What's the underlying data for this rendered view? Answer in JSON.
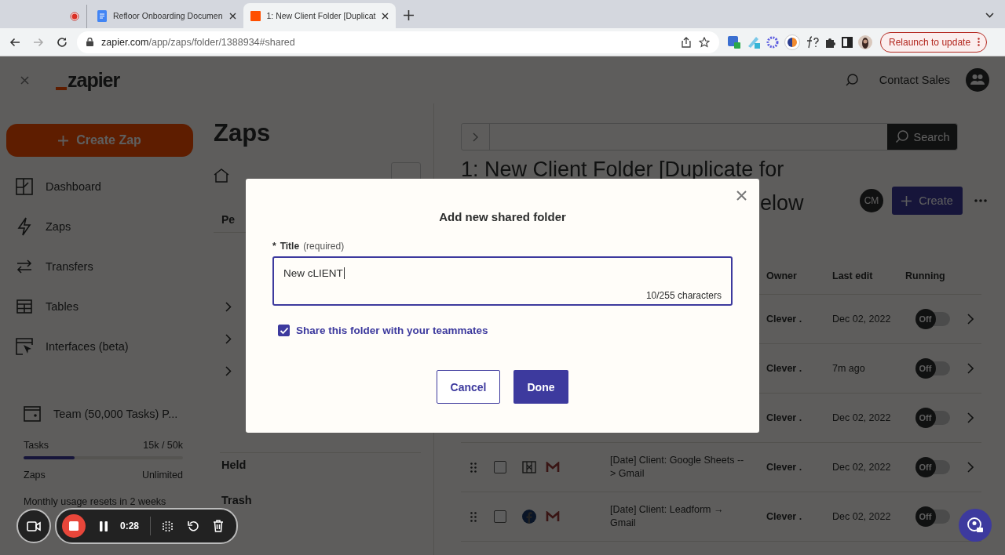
{
  "browser": {
    "tabs": [
      {
        "kind": "recording",
        "selected": false
      },
      {
        "kind": "doc",
        "title": "Refloor Onboarding Documen",
        "selected": false
      },
      {
        "kind": "zapier",
        "title": "1: New Client Folder [Duplicat",
        "selected": true
      }
    ],
    "url_host": "zapier.com",
    "url_path": "/app/zaps/folder/1388934#shared",
    "relaunch": "Relaunch to update"
  },
  "header": {
    "logo": "zapier",
    "contact": "Contact Sales"
  },
  "sidebar": {
    "create": "Create Zap",
    "items": [
      {
        "kind": "dashboard",
        "label": "Dashboard"
      },
      {
        "kind": "zaps",
        "label": "Zaps"
      },
      {
        "kind": "transfers",
        "label": "Transfers"
      },
      {
        "kind": "tables",
        "label": "Tables"
      },
      {
        "kind": "interfaces",
        "label": "Interfaces (beta)"
      }
    ],
    "plan": "Team (50,000 Tasks) P...",
    "usage": [
      {
        "label": "Tasks",
        "value": "15k / 50k",
        "level": 0.32
      },
      {
        "label": "Zaps",
        "value": "Unlimited"
      }
    ],
    "reset": "Monthly usage resets in 2 weeks"
  },
  "folders": {
    "title": "Zaps",
    "tab": "Pe",
    "links": [
      "Held",
      "Trash"
    ]
  },
  "main": {
    "search_button": "Search",
    "heading": [
      "1: New Client Folder [Duplicate for",
      "elow"
    ],
    "avatar": "CM",
    "create": "Create",
    "columns": [
      "Owner",
      "Last edit",
      "Running"
    ],
    "rows": [
      {
        "owner": "Clever .",
        "last_edit": "Dec 02, 2022",
        "on": false,
        "switch_label": "Off"
      },
      {
        "owner": "Clever .",
        "last_edit": "7m ago",
        "on": false,
        "switch_label": "Off"
      },
      {
        "owner": "Clever .",
        "last_edit": "Dec 02, 2022",
        "on": false,
        "switch_label": "Off"
      },
      {
        "checked": false,
        "apps": [
          {
            "kind": "sheets"
          },
          {
            "kind": "gmail"
          }
        ],
        "name": "[Date] Client: Google Sheets --> Gmail",
        "owner": "Clever .",
        "last_edit": "Dec 02, 2022",
        "on": false,
        "switch_label": "Off"
      },
      {
        "checked": false,
        "apps": [
          {
            "kind": "facebook"
          },
          {
            "kind": "gmail"
          }
        ],
        "name": "[Date] Client: Leadform → Gmail",
        "owner": "Clever .",
        "last_edit": "Dec 02, 2022",
        "on": false,
        "switch_label": "Off"
      }
    ]
  },
  "modal": {
    "title": "Add new shared folder",
    "asterisk": "*",
    "label": "Title",
    "hint": "(required)",
    "value": "New cLIENT",
    "counter": "10/255 characters",
    "share": {
      "label": "Share this folder with your teammates",
      "checked": true
    },
    "buttons": [
      {
        "kind": "secondary",
        "label": "Cancel"
      },
      {
        "kind": "primary",
        "label": "Done"
      }
    ]
  },
  "recorder": {
    "time": "0:28"
  }
}
